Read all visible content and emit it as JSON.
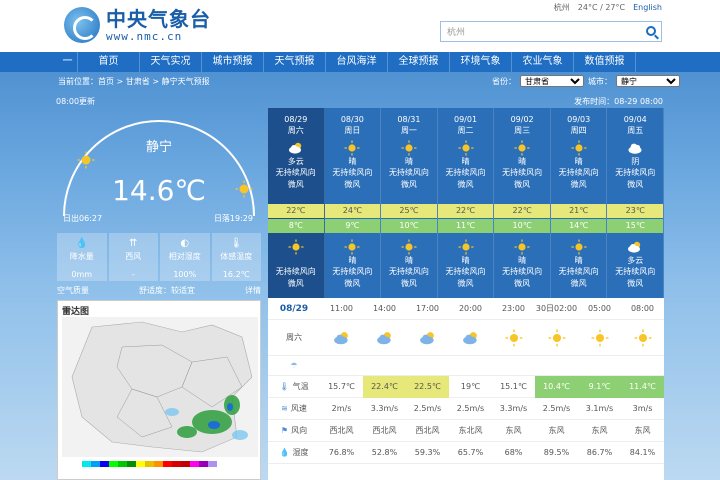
{
  "site": {
    "logo_cn": "中央气象台",
    "logo_en": "www.nmc.cn",
    "location_link": "杭州",
    "temp_link": "24°C / 27°C",
    "lang_link": "English",
    "search_value": "杭州"
  },
  "nav": [
    "一",
    "首页",
    "天气实况",
    "城市预报",
    "天气预报",
    "台风海洋",
    "全球预报",
    "环境气象",
    "农业气象",
    "数值预报"
  ],
  "breadcrumb": "当前位置：首页 > 甘肃省 > 静宁天气预报",
  "selects": {
    "province_label": "省份：",
    "province": "甘肃省",
    "city_label": "城市：",
    "city": "静宁"
  },
  "publish": {
    "left": "08:00更新",
    "right": "发布时间：08-29 08:00"
  },
  "current": {
    "city": "静宁",
    "temp": "14.6℃",
    "sunrise": "日出06:27",
    "sunset": "日落19:29"
  },
  "stats": [
    {
      "icon": "💧",
      "label": "降水量",
      "value": "0mm"
    },
    {
      "icon": "⇈",
      "label": "西风",
      "value": "-"
    },
    {
      "icon": "◐",
      "label": "相对湿度",
      "value": "100%"
    },
    {
      "icon": "🌡",
      "label": "体感温度",
      "value": "16.2℃"
    }
  ],
  "aq": {
    "label": "空气质量",
    "feel_label": "舒适度：",
    "feel_value": "较适宜",
    "more": "详情"
  },
  "radar": {
    "title": "雷达图"
  },
  "forecast": [
    {
      "date": "08/29",
      "week": "周六",
      "desc": "多云",
      "wind": "无持续风向",
      "level": "微风",
      "hi": "22℃",
      "lo": "8℃",
      "ndesc": "",
      "nwind": "无持续风向",
      "nlevel": "微风",
      "day": "cloud",
      "night": "sun"
    },
    {
      "date": "08/30",
      "week": "周日",
      "desc": "晴",
      "wind": "无持续风向",
      "level": "微风",
      "hi": "24℃",
      "lo": "9℃",
      "ndesc": "晴",
      "nwind": "无持续风向",
      "nlevel": "微风",
      "day": "sun",
      "night": "sun"
    },
    {
      "date": "08/31",
      "week": "周一",
      "desc": "晴",
      "wind": "无持续风向",
      "level": "微风",
      "hi": "25℃",
      "lo": "10℃",
      "ndesc": "晴",
      "nwind": "无持续风向",
      "nlevel": "微风",
      "day": "sun",
      "night": "sun"
    },
    {
      "date": "09/01",
      "week": "周二",
      "desc": "晴",
      "wind": "无持续风向",
      "level": "微风",
      "hi": "22℃",
      "lo": "11℃",
      "ndesc": "晴",
      "nwind": "无持续风向",
      "nlevel": "微风",
      "day": "sun",
      "night": "sun"
    },
    {
      "date": "09/02",
      "week": "周三",
      "desc": "晴",
      "wind": "无持续风向",
      "level": "微风",
      "hi": "22℃",
      "lo": "10℃",
      "ndesc": "晴",
      "nwind": "无持续风向",
      "nlevel": "微风",
      "day": "sun",
      "night": "sun"
    },
    {
      "date": "09/03",
      "week": "周四",
      "desc": "晴",
      "wind": "无持续风向",
      "level": "微风",
      "hi": "21℃",
      "lo": "14℃",
      "ndesc": "晴",
      "nwind": "无持续风向",
      "nlevel": "微风",
      "day": "sun",
      "night": "sun"
    },
    {
      "date": "09/04",
      "week": "周五",
      "desc": "阴",
      "wind": "无持续风向",
      "level": "微风",
      "hi": "23℃",
      "lo": "15℃",
      "ndesc": "多云",
      "nwind": "无持续风向",
      "nlevel": "微风",
      "day": "overcast",
      "night": "cloud"
    }
  ],
  "hourly": {
    "date": "08/29",
    "week": "周六",
    "times": [
      "11:00",
      "14:00",
      "17:00",
      "20:00",
      "23:00",
      "30日02:00",
      "05:00",
      "08:00"
    ],
    "icons": [
      "cloud",
      "cloud",
      "cloud",
      "cloud",
      "sun",
      "sun",
      "sun",
      "sun"
    ],
    "rows": [
      {
        "label": "气温",
        "icon": "🌡",
        "values": [
          "15.7℃",
          "22.4℃",
          "22.5℃",
          "19℃",
          "15.1℃",
          "10.4℃",
          "9.1℃",
          "11.4℃"
        ],
        "bands": [
          "",
          "y",
          "y",
          "",
          "",
          "g",
          "g",
          "g"
        ]
      },
      {
        "label": "风速",
        "icon": "≋",
        "values": [
          "2m/s",
          "3.3m/s",
          "2.5m/s",
          "2.5m/s",
          "3.3m/s",
          "2.5m/s",
          "3.1m/s",
          "3m/s"
        ],
        "bands": []
      },
      {
        "label": "风向",
        "icon": "⚑",
        "values": [
          "西北风",
          "西北风",
          "西北风",
          "东北风",
          "东风",
          "东风",
          "东风",
          "东风"
        ],
        "bands": []
      },
      {
        "label": "湿度",
        "icon": "💧",
        "values": [
          "76.8%",
          "52.8%",
          "59.3%",
          "65.7%",
          "68%",
          "89.5%",
          "86.7%",
          "84.1%"
        ],
        "bands": []
      }
    ]
  },
  "colors": {
    "nav": "#1f6ec4",
    "forecast_bg": "#2b6fb8",
    "hi_band": "#e6e87a",
    "lo_band": "#8dcf73"
  }
}
